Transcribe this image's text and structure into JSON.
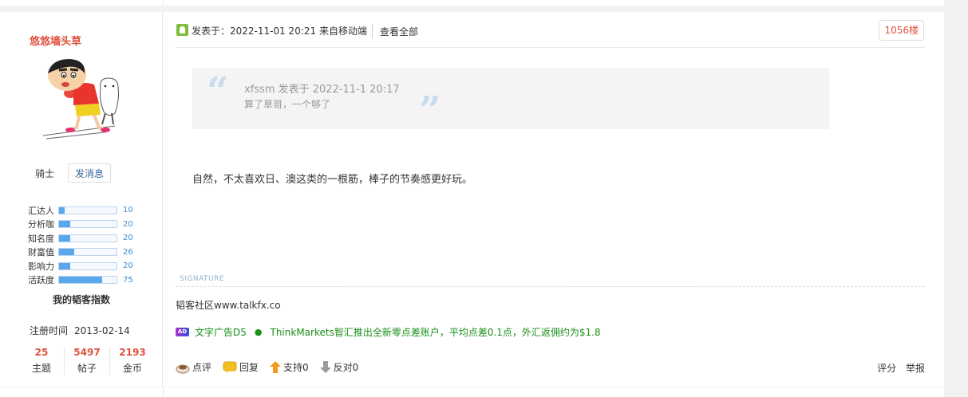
{
  "author": {
    "name": "悠悠墙头草",
    "rank": "骑士",
    "pm_label": "发消息",
    "metrics": [
      {
        "label": "汇达人",
        "value": "10",
        "fill": 0.1
      },
      {
        "label": "分析咖",
        "value": "20",
        "fill": 0.2
      },
      {
        "label": "知名度",
        "value": "20",
        "fill": 0.2
      },
      {
        "label": "财富值",
        "value": "26",
        "fill": 0.26
      },
      {
        "label": "影响力",
        "value": "20",
        "fill": 0.2
      },
      {
        "label": "活跃度",
        "value": "75",
        "fill": 0.75
      }
    ],
    "my_index": "我的韬客指数",
    "reg_label": "注册时间",
    "reg_date": "2013-02-14",
    "stats": [
      {
        "num": "25",
        "label": "主题"
      },
      {
        "num": "5497",
        "label": "帖子"
      },
      {
        "num": "2193",
        "label": "金币"
      }
    ]
  },
  "post": {
    "time": "发表于：2022-11-01 20:21  来自移动端",
    "view_all": "查看全部",
    "floor": "1056楼",
    "quote_author": "xfssm 发表于 2022-11-1 20:17",
    "quote_text": "算了草哥，一个够了",
    "content": "自然，不太喜欢日、澳这类的一根筋，棒子的节奏感更好玩。",
    "signature_title": "SIGNATURE",
    "signature": "韬客社区www.talkfx.co",
    "ad_icon": "AD",
    "ad_label": "文字广告D5",
    "ad_dot": "●",
    "ad_text": "ThinkMarkets智汇推出全新零点差账户，平均点差0.1点，外汇返佣约为$1.8"
  },
  "actions": {
    "rate": "点评",
    "reply": "回复",
    "support": "支持0",
    "oppose": "反对0",
    "score": "评分",
    "report": "举报"
  },
  "colors": {
    "accent": "#e0503e",
    "link_blue": "#3c8ad4",
    "ad_green": "#1a8f1a"
  }
}
